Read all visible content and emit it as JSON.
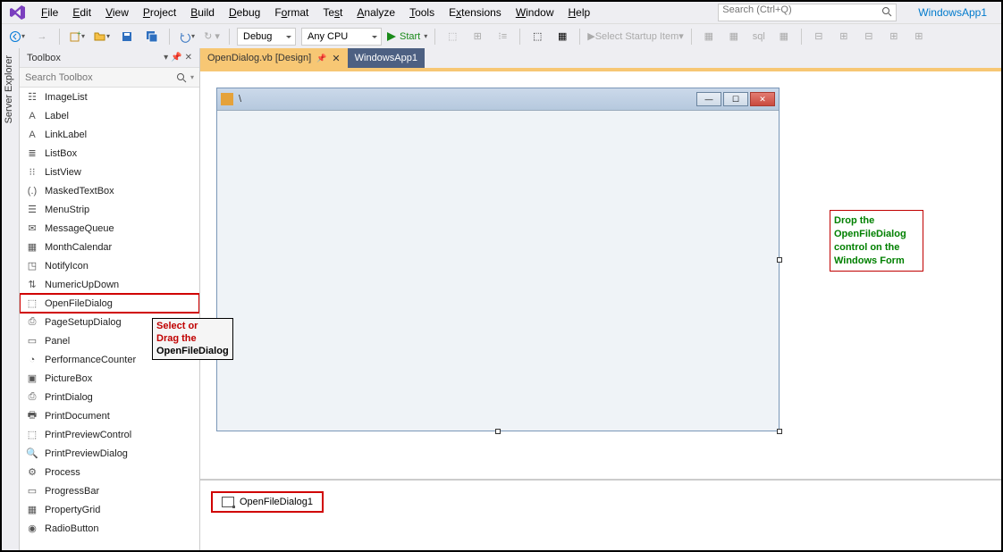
{
  "menubar": {
    "items": [
      {
        "label": "File",
        "u": "F"
      },
      {
        "label": "Edit",
        "u": "E"
      },
      {
        "label": "View",
        "u": "V"
      },
      {
        "label": "Project",
        "u": "P"
      },
      {
        "label": "Build",
        "u": "B"
      },
      {
        "label": "Debug",
        "u": "D"
      },
      {
        "label": "Format",
        "u": "o"
      },
      {
        "label": "Test",
        "u": "s"
      },
      {
        "label": "Analyze",
        "u": "A"
      },
      {
        "label": "Tools",
        "u": "T"
      },
      {
        "label": "Extensions",
        "u": "x"
      },
      {
        "label": "Window",
        "u": "W"
      },
      {
        "label": "Help",
        "u": "H"
      }
    ],
    "search_placeholder": "Search (Ctrl+Q)",
    "project_name": "WindowsApp1"
  },
  "toolbar": {
    "config": "Debug",
    "platform": "Any CPU",
    "start_label": "Start",
    "startup_label": "Select Startup Item"
  },
  "side_tab_label": "Server Explorer",
  "toolbox": {
    "title": "Toolbox",
    "search_placeholder": "Search Toolbox",
    "items": [
      {
        "label": "ImageList",
        "icon": "☷"
      },
      {
        "label": "Label",
        "icon": "A"
      },
      {
        "label": "LinkLabel",
        "icon": "A"
      },
      {
        "label": "ListBox",
        "icon": "≣"
      },
      {
        "label": "ListView",
        "icon": "⁝⁝"
      },
      {
        "label": "MaskedTextBox",
        "icon": "(.)"
      },
      {
        "label": "MenuStrip",
        "icon": "☰"
      },
      {
        "label": "MessageQueue",
        "icon": "✉"
      },
      {
        "label": "MonthCalendar",
        "icon": "▦"
      },
      {
        "label": "NotifyIcon",
        "icon": "◳"
      },
      {
        "label": "NumericUpDown",
        "icon": "⇅"
      },
      {
        "label": "OpenFileDialog",
        "icon": "⬚",
        "highlighted": true
      },
      {
        "label": "PageSetupDialog",
        "icon": "⎙"
      },
      {
        "label": "Panel",
        "icon": "▭"
      },
      {
        "label": "PerformanceCounter",
        "icon": "◔"
      },
      {
        "label": "PictureBox",
        "icon": "▣"
      },
      {
        "label": "PrintDialog",
        "icon": "⎙"
      },
      {
        "label": "PrintDocument",
        "icon": "🖶"
      },
      {
        "label": "PrintPreviewControl",
        "icon": "⬚"
      },
      {
        "label": "PrintPreviewDialog",
        "icon": "🔍"
      },
      {
        "label": "Process",
        "icon": "⚙"
      },
      {
        "label": "ProgressBar",
        "icon": "▭"
      },
      {
        "label": "PropertyGrid",
        "icon": "▦"
      },
      {
        "label": "RadioButton",
        "icon": "◉"
      }
    ]
  },
  "tabs": {
    "active": "OpenDialog.vb [Design]",
    "inactive": "WindowsApp1"
  },
  "form": {
    "title": "\\"
  },
  "tray": {
    "item": "OpenFileDialog1"
  },
  "callout1": {
    "line1": "Select or",
    "line2": "Drag the",
    "line3": "OpenFileDialog"
  },
  "callout2": {
    "line1": "Drop the",
    "line2": "OpenFileDialog",
    "line3": "control on the",
    "line4": "Windows Form"
  }
}
